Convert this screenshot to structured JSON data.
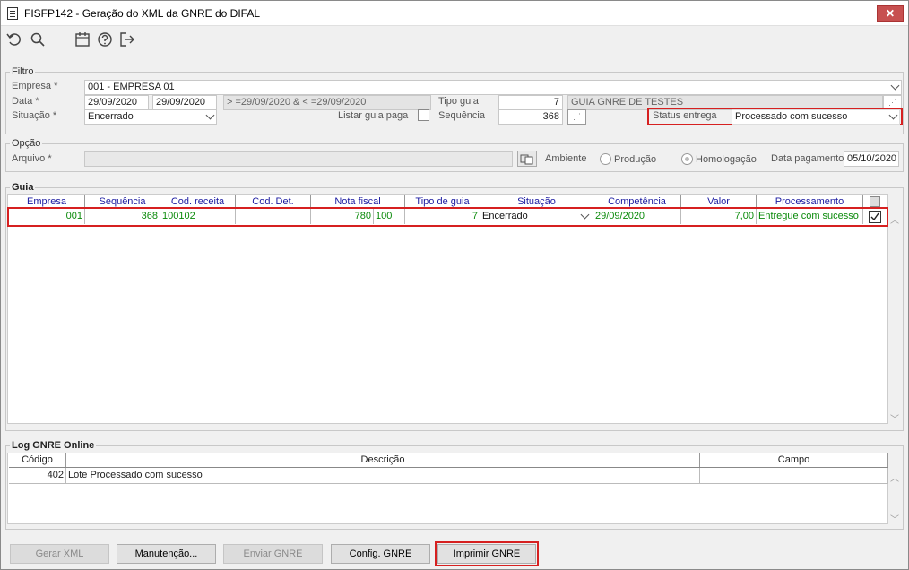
{
  "window": {
    "title": "FISFP142 - Geração do XML da GNRE do DIFAL",
    "close_label": "✕"
  },
  "toolbar": {
    "icons": [
      "undo-icon",
      "search-icon",
      "calendar-icon",
      "help-icon",
      "exit-icon"
    ]
  },
  "filtro": {
    "legend": "Filtro",
    "empresa_label": "Empresa *",
    "empresa_value": "001 - EMPRESA 01",
    "data_label": "Data *",
    "data_from": "29/09/2020",
    "data_to": "29/09/2020",
    "data_expr": "> =29/09/2020 & < =29/09/2020",
    "tipo_guia_label": "Tipo guia",
    "tipo_guia_code": "7",
    "tipo_guia_desc": "GUIA GNRE DE TESTES",
    "situacao_label": "Situação *",
    "situacao_value": "Encerrado",
    "listar_label": "Listar guia paga",
    "sequencia_label": "Sequência",
    "sequencia_value": "368",
    "status_label": "Status entrega",
    "status_value": "Processado com sucesso"
  },
  "opcao": {
    "legend": "Opção",
    "arquivo_label": "Arquivo *",
    "arquivo_value": "",
    "ambiente_label": "Ambiente",
    "producao_label": "Produção",
    "homologacao_label": "Homologação",
    "data_pagamento_label": "Data pagamento",
    "data_pagamento_value": "05/10/2020"
  },
  "guia": {
    "legend": "Guia",
    "columns": [
      "Empresa",
      "Sequência",
      "Cod. receita",
      "Cod. Det.",
      "Nota fiscal",
      "Tipo de guia",
      "Situação",
      "Competência",
      "Valor",
      "Processamento"
    ],
    "row": {
      "empresa": "001",
      "sequencia": "368",
      "cod_receita": "100102",
      "cod_det": "",
      "nota_fiscal": "780",
      "nota_serie": "100",
      "tipo_guia": "7",
      "situacao": "Encerrado",
      "competencia": "29/09/2020",
      "valor": "7,00",
      "processamento": "Entregue com sucesso",
      "checked": true
    }
  },
  "log": {
    "legend": "Log GNRE Online",
    "columns": [
      "Código",
      "Descrição",
      "Campo"
    ],
    "row": {
      "codigo": "402",
      "descricao": "Lote Processado com sucesso",
      "campo": ""
    }
  },
  "buttons": {
    "gerar_xml": "Gerar XML",
    "manutencao": "Manutenção...",
    "enviar_gnre": "Enviar GNRE",
    "config_gnre": "Config. GNRE",
    "imprimir_gnre": "Imprimir GNRE"
  },
  "colors": {
    "header_text": "#1a1aa0",
    "row_text": "#0a8a0a",
    "highlight": "#d62020"
  }
}
